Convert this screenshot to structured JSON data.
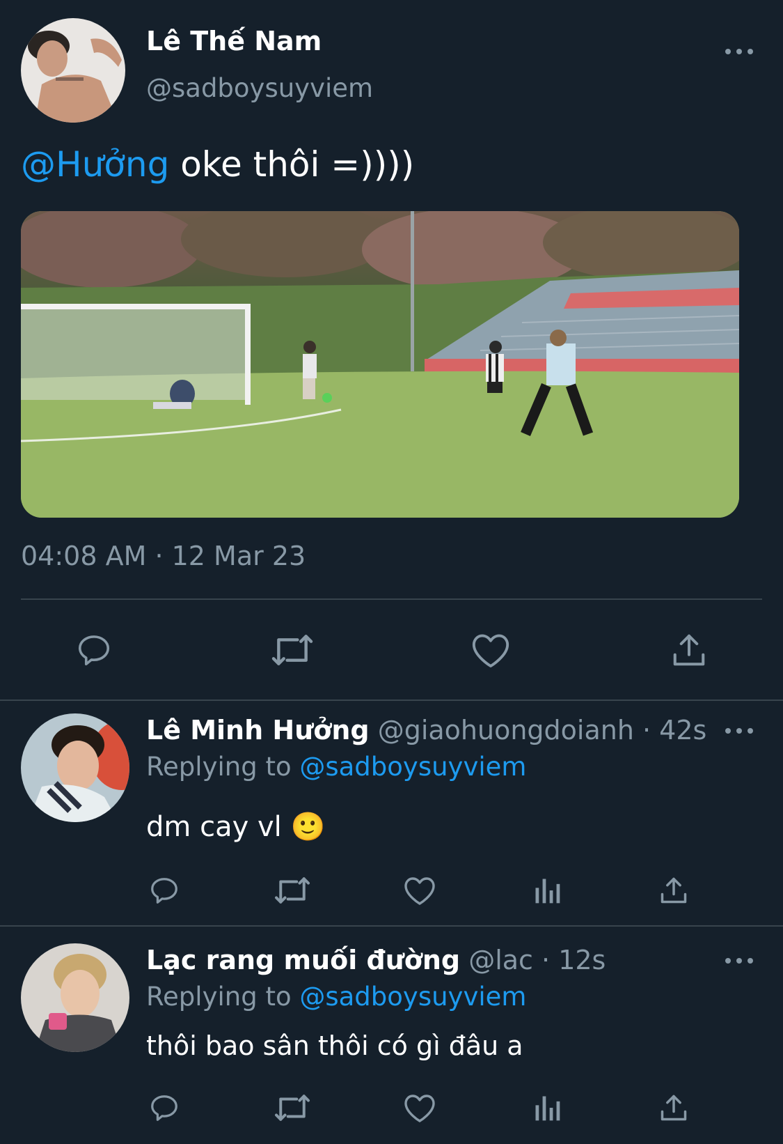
{
  "main_tweet": {
    "display_name": "Lê Thế Nam",
    "handle": "@sadboysuyviem",
    "mention": "@Hưởng",
    "text": " oke thôi =))))",
    "timestamp": "04:08 AM · 12 Mar 23",
    "actions": [
      "reply-icon",
      "retweet-icon",
      "like-icon",
      "share-icon"
    ]
  },
  "replies": [
    {
      "display_name": "Lê Minh Hưởng",
      "handle": "@giaohuongdoianh",
      "time": " · 42s",
      "replying_label": "Replying to ",
      "replying_handle": "@sadboysuyviem",
      "text": "dm cay vl 🙂",
      "actions": [
        "reply-icon",
        "retweet-icon",
        "like-icon",
        "analytics-icon",
        "share-icon"
      ]
    },
    {
      "display_name": "Lạc rang muối đường",
      "handle": "@lac",
      "time": " · 12s",
      "replying_label": "Replying to ",
      "replying_handle": "@sadboysuyviem",
      "text": "thôi bao sân thôi có gì đâu a",
      "actions": [
        "reply-icon",
        "retweet-icon",
        "like-icon",
        "analytics-icon",
        "share-icon"
      ]
    }
  ],
  "colors": {
    "background": "#15202b",
    "accent": "#1d9bf0",
    "muted": "#8899a6",
    "divider": "#38444d"
  }
}
